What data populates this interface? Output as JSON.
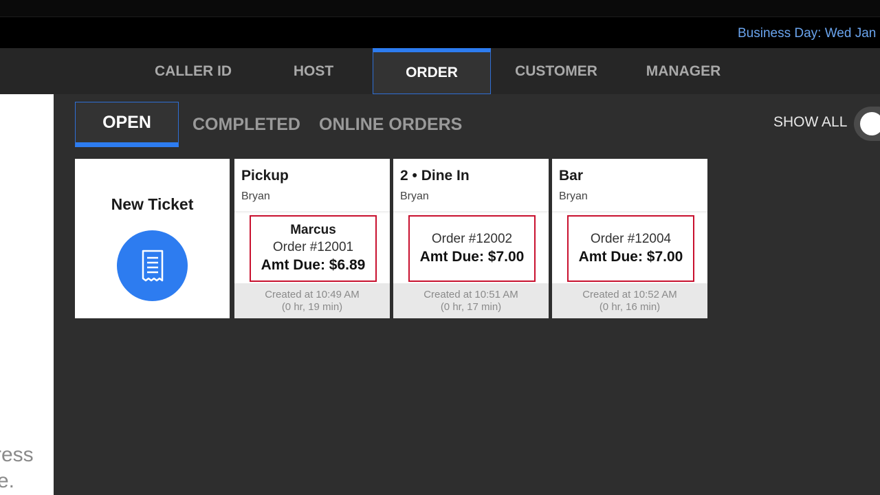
{
  "header": {
    "business_day": "Business Day: Wed Jan"
  },
  "nav": {
    "tabs": [
      {
        "label": "CALLER ID"
      },
      {
        "label": "HOST"
      },
      {
        "label": "ORDER"
      },
      {
        "label": "CUSTOMER"
      },
      {
        "label": "MANAGER"
      }
    ],
    "active": "ORDER"
  },
  "left_panel": {
    "fragment1": "ress",
    "fragment2": "e."
  },
  "subtabs": {
    "open": "OPEN",
    "completed": "COMPLETED",
    "online_orders": "ONLINE ORDERS"
  },
  "show_all": {
    "label": "SHOW ALL",
    "on": true
  },
  "new_ticket": {
    "label": "New Ticket",
    "icon": "receipt-icon"
  },
  "tickets": [
    {
      "title": "Pickup",
      "server": "Bryan",
      "customer": "Marcus",
      "order": "Order #12001",
      "amount_due": "Amt Due: $6.89",
      "created": "Created at 10:49 AM",
      "elapsed": "(0 hr, 19 min)"
    },
    {
      "title": "2 • Dine In",
      "server": "Bryan",
      "order": "Order #12002",
      "amount_due": "Amt Due: $7.00",
      "created": "Created at 10:51 AM",
      "elapsed": "(0 hr, 17 min)"
    },
    {
      "title": "Bar",
      "server": "Bryan",
      "order": "Order #12004",
      "amount_due": "Amt Due: $7.00",
      "created": "Created at 10:52 AM",
      "elapsed": "(0 hr, 16 min)"
    }
  ],
  "colors": {
    "accent": "#2d7cf0",
    "highlight_border": "#c8102e",
    "business_day": "#6aa4ee"
  }
}
